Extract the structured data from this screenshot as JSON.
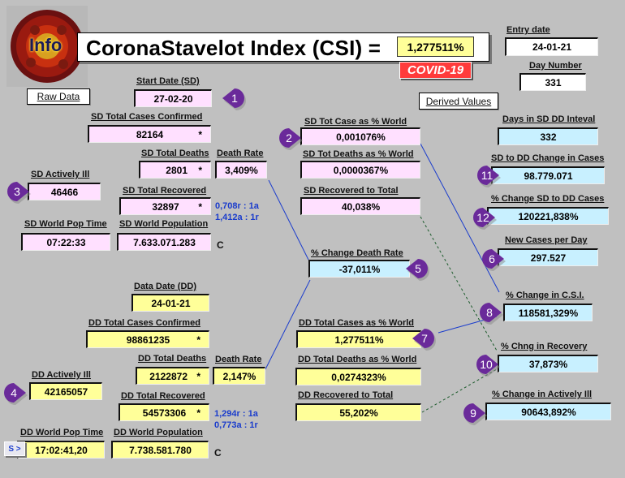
{
  "header": {
    "logo_text": "Info",
    "title": "CoronaStavelot Index (CSI) =",
    "csi_value": "1,277511%",
    "badge": "COVID-19"
  },
  "entry": {
    "entry_date_label": "Entry date",
    "entry_date": "24-01-21",
    "day_number_label": "Day Number",
    "day_number": "331"
  },
  "buttons": {
    "raw_data": "Raw Data",
    "derived_values": "Derived Values",
    "s_button": "S >"
  },
  "sd": {
    "start_date_label": "Start Date (SD)",
    "start_date": "27-02-20",
    "total_cases_label": "SD Total Cases Confirmed",
    "total_cases": "82164",
    "total_deaths_label": "SD Total Deaths",
    "total_deaths": "2801",
    "death_rate_label": "Death Rate",
    "death_rate": "3,409%",
    "actively_ill_label": "SD Actively Ill",
    "actively_ill": "46466",
    "total_recovered_label": "SD Total Recovered",
    "total_recovered": "32897",
    "ratio_1": "0,708r : 1a",
    "ratio_2": "1,412a : 1r",
    "world_pop_time_label": "SD World Pop Time",
    "world_pop_time": "07:22:33",
    "world_population_label": "SD World Population",
    "world_population": "7.633.071.283",
    "c_mark": "C",
    "tot_case_pct_world_label": "SD Tot Case as % World",
    "tot_case_pct_world": "0,001076%",
    "tot_deaths_pct_world_label": "SD Tot Deaths as % World",
    "tot_deaths_pct_world": "0,0000367%",
    "recovered_to_total_label": "SD Recovered to Total",
    "recovered_to_total": "40,038%"
  },
  "dd": {
    "data_date_label": "Data Date (DD)",
    "data_date": "24-01-21",
    "total_cases_label": "DD Total Cases Confirmed",
    "total_cases": "98861235",
    "total_deaths_label": "DD Total Deaths",
    "total_deaths": "2122872",
    "death_rate_label": "Death Rate",
    "death_rate": "2,147%",
    "actively_ill_label": "DD Actively Ill",
    "actively_ill": "42165057",
    "total_recovered_label": "DD Total Recovered",
    "total_recovered": "54573306",
    "ratio_1": "1,294r : 1a",
    "ratio_2": "0,773a : 1r",
    "world_pop_time_label": "DD World Pop Time",
    "world_pop_time": "17:02:41,20",
    "world_population_label": "DD World Population",
    "world_population": "7.738.581.780",
    "c_mark": "C",
    "tot_case_pct_world_label": "DD Total Cases as % World",
    "tot_case_pct_world": "1,277511%",
    "tot_deaths_pct_world_label": "DD Total Deaths as % World",
    "tot_deaths_pct_world": "0,0274323%",
    "recovered_to_total_label": "DD Recovered to Total",
    "recovered_to_total": "55,202%"
  },
  "asterisk": "*",
  "derived": {
    "pct_change_death_rate_label": "% Change Death Rate",
    "pct_change_death_rate": "-37,011%",
    "days_interval_label": "Days in SD DD Inteval",
    "days_interval": "332",
    "change_cases_label": "SD to DD Change in Cases",
    "change_cases": "98.779.071",
    "pct_change_cases_label": "% Change SD to DD Cases",
    "pct_change_cases": "120221,838%",
    "new_cases_per_day_label": "New Cases per Day",
    "new_cases_per_day": "297.527",
    "pct_change_csi_label": "% Change in C.S.I.",
    "pct_change_csi": "118581,329%",
    "pct_change_recovery_label": "% Chng in Recovery",
    "pct_change_recovery": "37,873%",
    "pct_change_actively_ill_label": "% Change in Actively Ill",
    "pct_change_actively_ill": "90643,892%"
  },
  "markers": [
    "1",
    "2",
    "3",
    "4",
    "5",
    "6",
    "7",
    "8",
    "9",
    "10",
    "11",
    "12"
  ],
  "colors": {
    "background": "#c0c0c0",
    "sd_fill": "#ffe0ff",
    "dd_fill": "#ffff99",
    "derived_fill": "#c8f0ff",
    "marker": "#6a2a9a",
    "badge": "#ff3b3b",
    "ratio_text": "#1a3ccc",
    "connector": "#1a3ccc",
    "dotted_connector": "#1a5a2a"
  }
}
